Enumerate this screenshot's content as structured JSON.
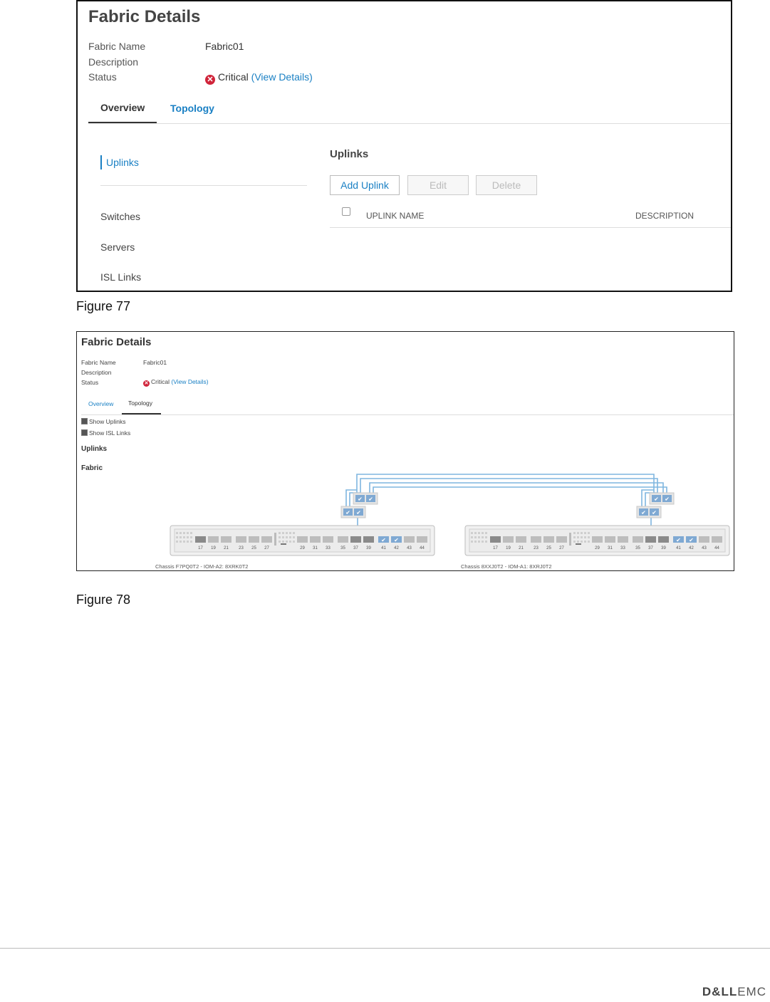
{
  "figure77": {
    "title": "Fabric Details",
    "fields": {
      "fabric_name_label": "Fabric Name",
      "fabric_name_value": "Fabric01",
      "description_label": "Description",
      "status_label": "Status",
      "status_value": "Critical",
      "view_details": "(View Details)"
    },
    "tabs": [
      "Overview",
      "Topology"
    ],
    "active_tab": "Overview",
    "sidebar": {
      "selected": "Uplinks",
      "items": [
        "Switches",
        "Servers",
        "ISL Links"
      ]
    },
    "main": {
      "heading": "Uplinks",
      "buttons": {
        "add": "Add Uplink",
        "edit": "Edit",
        "delete": "Delete"
      },
      "columns": [
        "UPLINK NAME",
        "DESCRIPTION"
      ]
    },
    "caption": "Figure 77"
  },
  "figure78": {
    "title": "Fabric Details",
    "fields": {
      "fabric_name_label": "Fabric Name",
      "fabric_name_value": "Fabric01",
      "description_label": "Description",
      "status_label": "Status",
      "status_value": "Critical",
      "view_details": "(View Details)"
    },
    "tabs": [
      "Overview",
      "Topology"
    ],
    "active_tab": "Topology",
    "checkboxes": [
      "Show Uplinks",
      "Show ISL Links"
    ],
    "sections": [
      "Uplinks",
      "Fabric"
    ],
    "port_numbers": [
      "17",
      "19",
      "21",
      "23",
      "25",
      "27",
      "29",
      "31",
      "33",
      "35",
      "37",
      "39",
      "41",
      "42",
      "43",
      "44"
    ],
    "chassis_left": "Chassis F7PQ0T2 - IOM-A2: 8XRK0T2",
    "chassis_right": "Chassis 8XXJ0T2 - IOM-A1: 8XRJ0T2",
    "caption": "Figure 78"
  },
  "footer": {
    "logo_dell": "D&LL",
    "logo_emc": "EMC"
  },
  "colors": {
    "accent": "#1a80c4",
    "critical": "#d0243a",
    "link_line": "#7fb6df",
    "port_selected": "#7fa9d3"
  }
}
